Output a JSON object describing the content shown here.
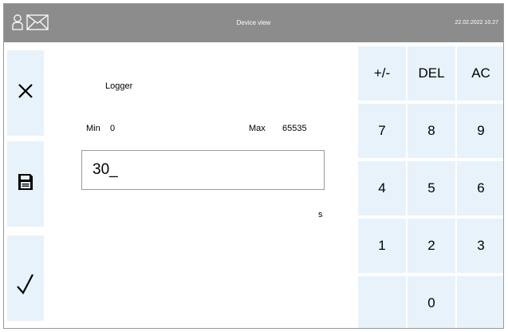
{
  "header": {
    "title": "Device view",
    "datetime": "22.02.2022 10.27",
    "icons": [
      "user-icon",
      "mail-icon"
    ]
  },
  "sidebar": {
    "buttons": [
      "close-icon",
      "save-icon",
      "confirm-icon"
    ]
  },
  "main": {
    "label": "Logger",
    "min_label": "Min",
    "min_value": "0",
    "max_label": "Max",
    "max_value": "65535",
    "input_value": "30_",
    "unit": "s"
  },
  "keypad": {
    "row1": [
      "+/-",
      "DEL",
      "AC"
    ],
    "row2": [
      "7",
      "8",
      "9"
    ],
    "row3": [
      "4",
      "5",
      "6"
    ],
    "row4": [
      "1",
      "2",
      "3"
    ],
    "row5": [
      "",
      "0",
      ""
    ]
  },
  "colors": {
    "header_bg": "#8c8c8c",
    "button_bg": "#e8f2fa"
  }
}
